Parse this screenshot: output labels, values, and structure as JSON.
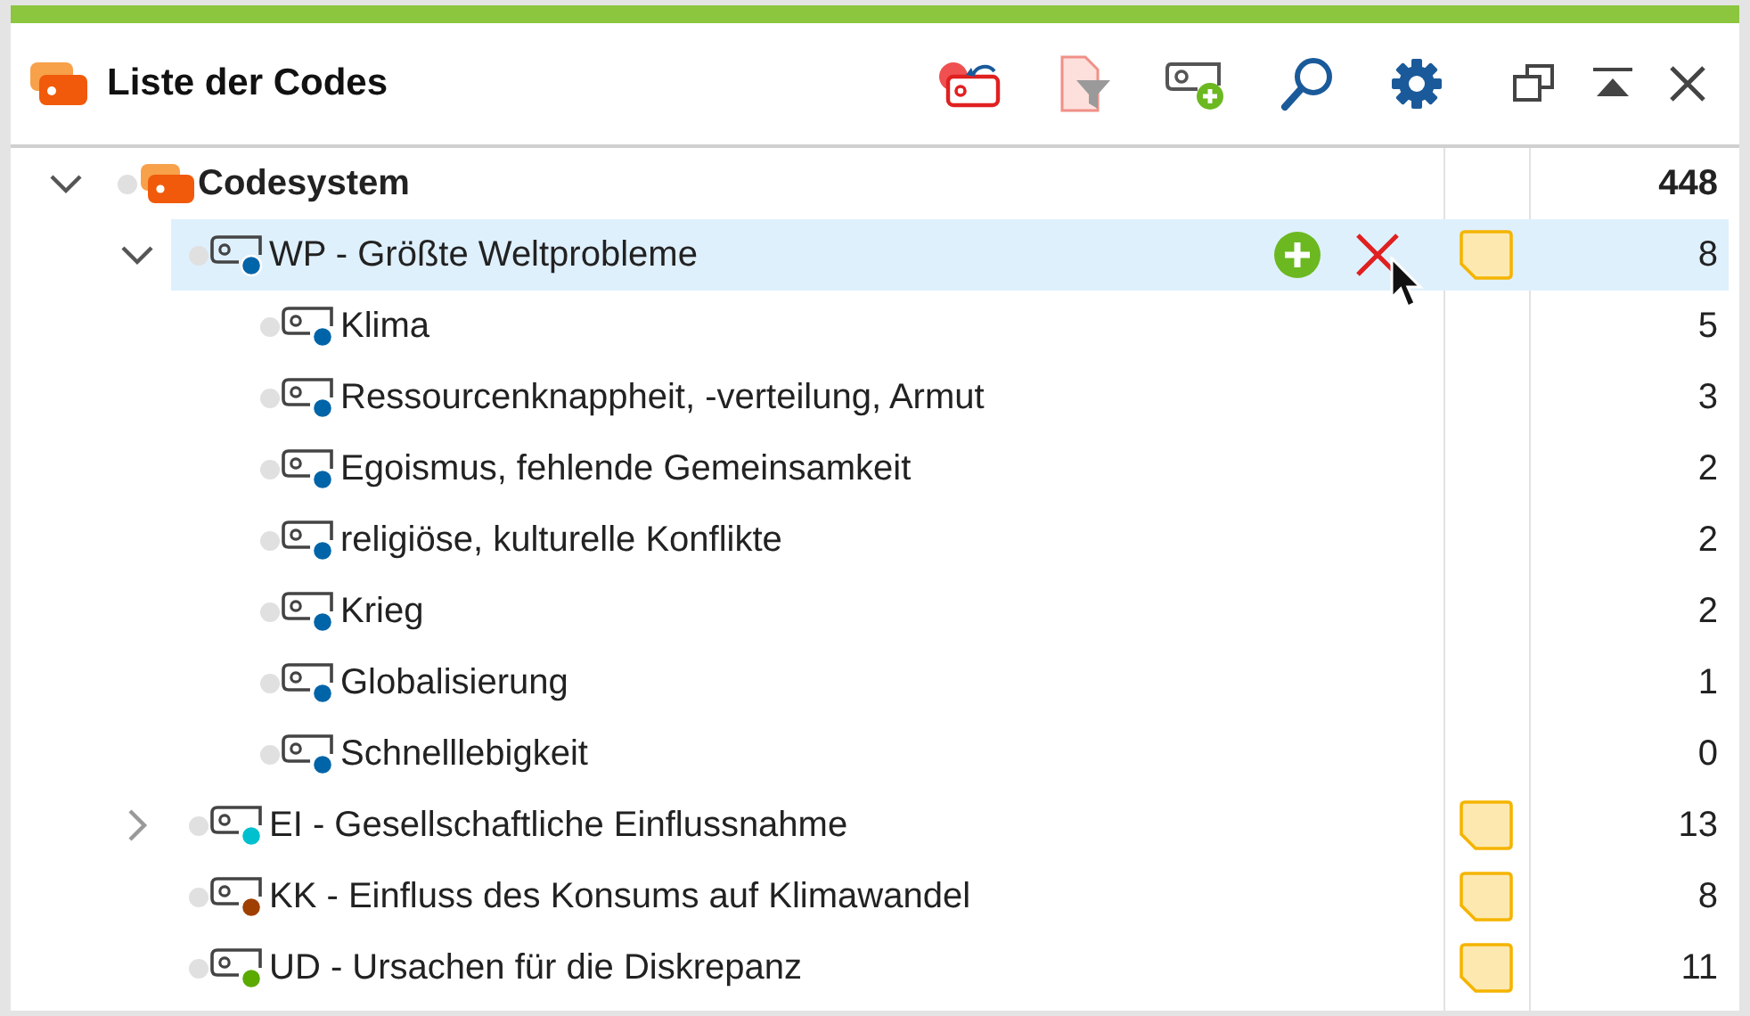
{
  "window": {
    "title": "Liste der Codes"
  },
  "toolbar": [
    {
      "kind": "reset"
    },
    {
      "kind": "filter"
    },
    {
      "kind": "newcode"
    },
    {
      "kind": "search"
    },
    {
      "kind": "settings"
    }
  ],
  "window_controls": [
    {
      "kind": "undock"
    },
    {
      "kind": "collapse"
    },
    {
      "kind": "close"
    }
  ],
  "tree": [
    {
      "kind": "codesystem",
      "label": "Codesystem",
      "count": "448",
      "expanded": true,
      "children": [
        {
          "kind": "code",
          "label": "WP - Größte Weltprobleme",
          "count": "8",
          "color": "#0064a8",
          "memo": true,
          "selected": true,
          "expanded": true,
          "children": [
            {
              "kind": "code",
              "label": "Klima",
              "count": "5",
              "color": "#0064a8",
              "memo": false,
              "selected": false
            },
            {
              "kind": "code",
              "label": "Ressourcenknappheit, -verteilung, Armut",
              "count": "3",
              "color": "#0064a8",
              "memo": false,
              "selected": false
            },
            {
              "kind": "code",
              "label": "Egoismus, fehlende Gemeinsamkeit",
              "count": "2",
              "color": "#0064a8",
              "memo": false,
              "selected": false
            },
            {
              "kind": "code",
              "label": "religiöse, kulturelle Konflikte",
              "count": "2",
              "color": "#0064a8",
              "memo": false,
              "selected": false
            },
            {
              "kind": "code",
              "label": "Krieg",
              "count": "2",
              "color": "#0064a8",
              "memo": false,
              "selected": false
            },
            {
              "kind": "code",
              "label": "Globalisierung",
              "count": "1",
              "color": "#0064a8",
              "memo": false,
              "selected": false
            },
            {
              "kind": "code",
              "label": "Schnelllebigkeit",
              "count": "0",
              "color": "#0064a8",
              "memo": false,
              "selected": false
            }
          ]
        },
        {
          "kind": "code",
          "label": "EI - Gesellschaftliche Einflussnahme",
          "count": "13",
          "color": "#00c0d0",
          "memo": true,
          "selected": false,
          "expanded": false
        },
        {
          "kind": "code",
          "label": "KK - Einfluss des Konsums auf Klimawandel",
          "count": "8",
          "color": "#a04000",
          "memo": true,
          "selected": false
        },
        {
          "kind": "code",
          "label": "UD - Ursachen für die Diskrepanz",
          "count": "11",
          "color": "#5aaa00",
          "memo": true,
          "selected": false
        }
      ]
    }
  ]
}
